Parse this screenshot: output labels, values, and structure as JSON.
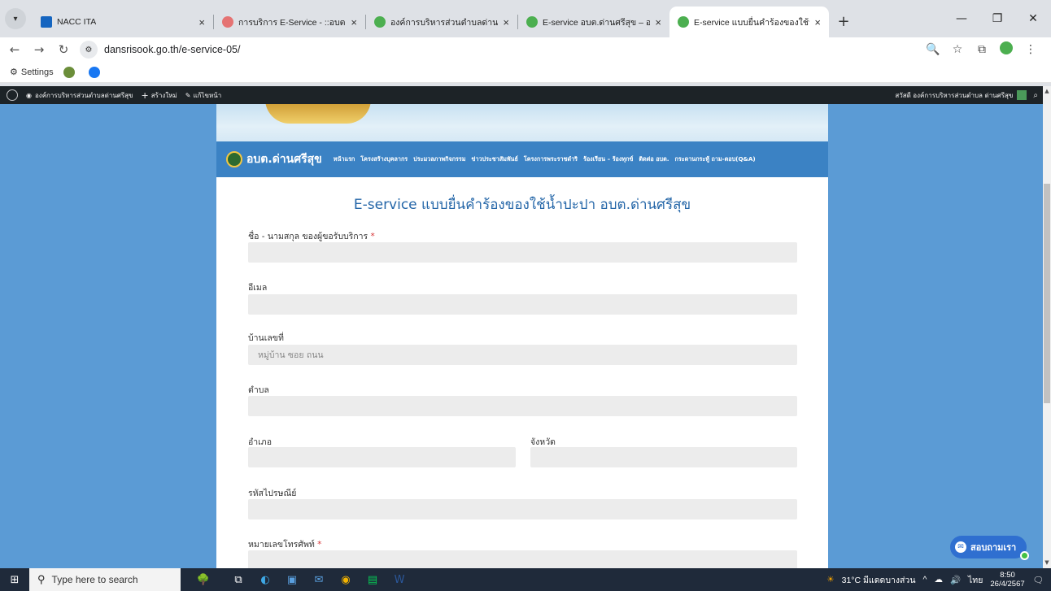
{
  "browser": {
    "tabs": [
      {
        "title": "NACC ITA",
        "favicon_color": "#1565c0"
      },
      {
        "title": "การบริการ E-Service - ::อบต.โคกหล่…",
        "favicon_color": "#e57373"
      },
      {
        "title": "องค์การบริหารส่วนตำบลด่านศรีสุข -…",
        "favicon_color": "#4caf50"
      },
      {
        "title": "E-service อบต.ด่านศรีสุข – องค์การ…",
        "favicon_color": "#4caf50"
      },
      {
        "title": "E-service แบบยื่นคำร้องของใช้น้ำปะป…",
        "favicon_color": "#4caf50"
      }
    ],
    "active_tab": 4,
    "close_glyph": "×",
    "new_tab_glyph": "+",
    "url": "dansrisook.go.th/e-service-05/",
    "bookmarks": [
      {
        "label": "Settings"
      },
      {
        "label": ""
      },
      {
        "label": ""
      }
    ]
  },
  "wp_admin_bar": {
    "site_link": "องค์การบริหารส่วนตำบลด่านศรีสุข",
    "new_link": "สร้างใหม่",
    "edit_link": "แก้ไขหน้า",
    "greeting": "สวัสดี องค์การบริหารส่วนตำบล ด่านศรีสุข"
  },
  "site": {
    "name": "อบต.ด่านศรีสุข",
    "menu": [
      "หน้าแรก",
      "โครงสร้างบุคลากร",
      "ประมวลภาพกิจกรรม",
      "ข่าวประชาสัมพันธ์",
      "โครงการพระราชดำริ",
      "ร้องเรียน – ร้องทุกข์",
      "ติดต่อ อบต.",
      "กระดานกระทู้ ถาม-ตอบ(Q&A)"
    ]
  },
  "form": {
    "title": "E-service แบบยื่นคำร้องของใช้น้ำปะปา อบต.ด่านศรีสุข",
    "required_mark": "*",
    "fields": {
      "name": {
        "label": "ชื่อ - นามสกุล ของผู้ขอรับบริการ",
        "placeholder": ""
      },
      "email": {
        "label": "อีเมล",
        "placeholder": ""
      },
      "house": {
        "label": "บ้านเลขที่",
        "placeholder": "หมู่บ้าน ซอย ถนน"
      },
      "subdistrict": {
        "label": "ตำบล",
        "placeholder": ""
      },
      "district": {
        "label": "อำเภอ",
        "placeholder": ""
      },
      "province": {
        "label": "จังหวัด",
        "placeholder": ""
      },
      "postal": {
        "label": "รหัสไปรษณีย์",
        "placeholder": ""
      },
      "phone": {
        "label": "หมายเลขโทรศัพท์",
        "placeholder": ""
      }
    }
  },
  "chat": {
    "label": "สอบถามเรา"
  },
  "taskbar": {
    "search_placeholder": "Type here to search",
    "weather": "31°C มีแดดบางส่วน",
    "language": "ไทย",
    "time": "8:50",
    "date": "26/4/2567"
  }
}
